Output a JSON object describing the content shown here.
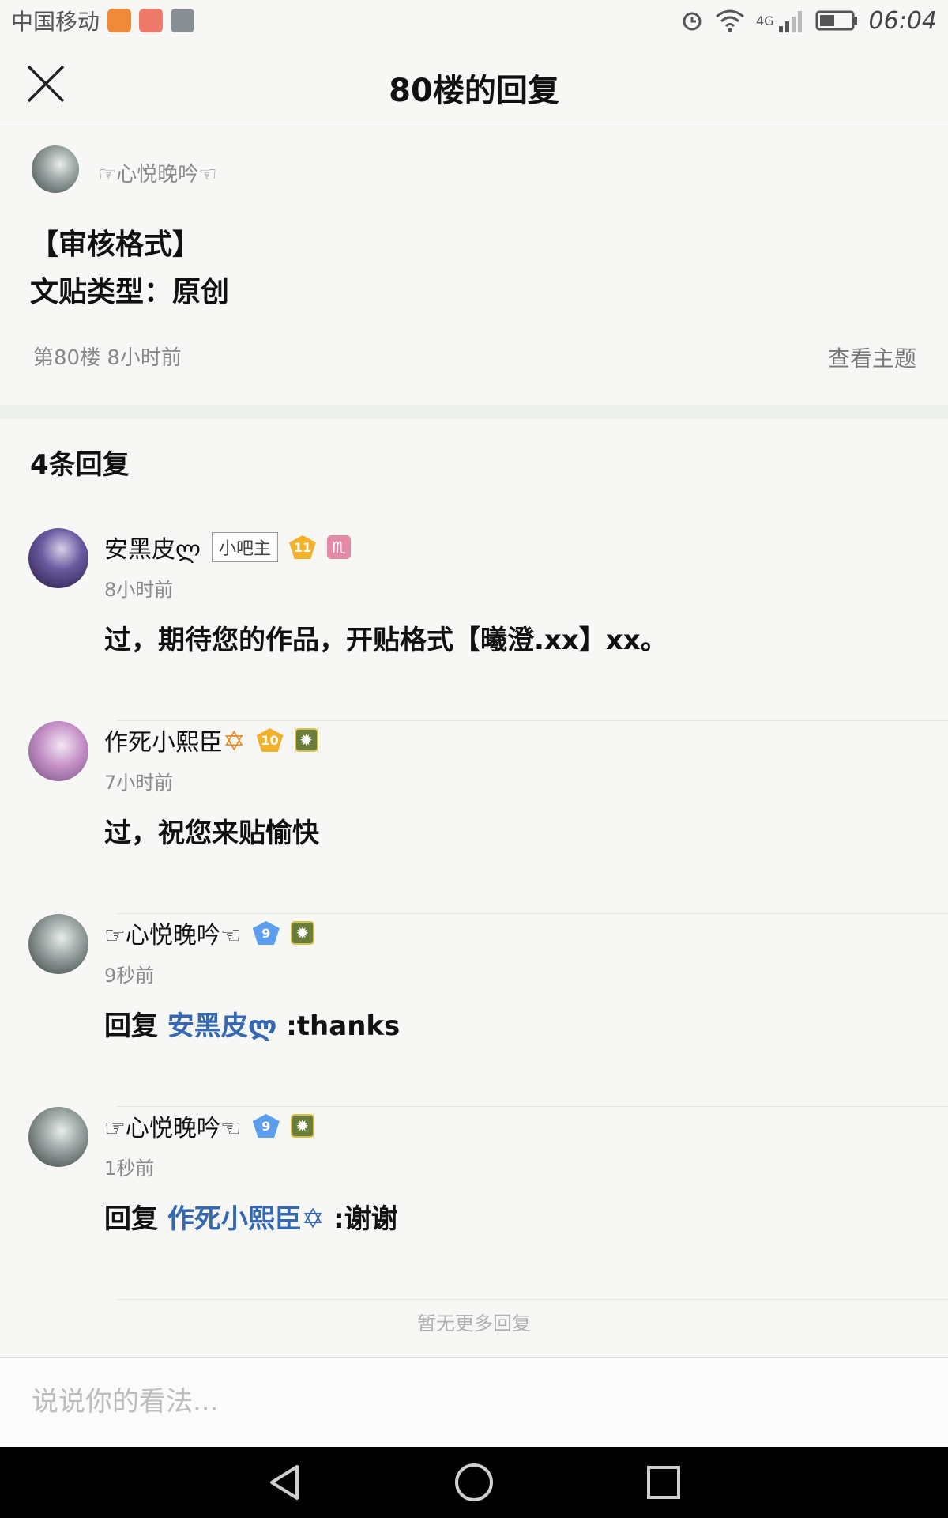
{
  "status_bar": {
    "carrier": "中国移动",
    "network": "4G",
    "time": "06:04",
    "colors": {
      "app1": "#f08a3a",
      "app2": "#f07a6a",
      "app3": "#8a8e95"
    }
  },
  "header": {
    "title": "80楼的回复",
    "close_icon": "close-icon"
  },
  "post": {
    "author": "☞心悦晚吟☜",
    "lines": [
      "【审核格式】",
      "文贴类型：原创"
    ],
    "meta": "第80楼  8小时前",
    "view_topic_label": "查看主题"
  },
  "replies": {
    "count_label": "4条回复",
    "items": [
      {
        "author": "安黑皮ლ",
        "role_badge": "小吧主",
        "level": "11",
        "level_color": "gold",
        "extra_badge": "♏",
        "time": "8小时前",
        "prefix": "",
        "mention": "",
        "text": "过，期待您的作品，开贴格式【曦澄.xx】xx。"
      },
      {
        "author": "作死小熙臣",
        "name_icon": "✡",
        "level": "10",
        "level_color": "gold",
        "extra_badge": "✹",
        "time": "7小时前",
        "prefix": "",
        "mention": "",
        "text": "过，祝您来贴愉快"
      },
      {
        "author": "☞心悦晚吟☜",
        "level": "9",
        "level_color": "blue",
        "extra_badge": "✹",
        "time": "9秒前",
        "prefix": "回复 ",
        "mention": "安黑皮ლ",
        "text": " :thanks"
      },
      {
        "author": "☞心悦晚吟☜",
        "level": "9",
        "level_color": "blue",
        "extra_badge": "✹",
        "time": "1秒前",
        "prefix": "回复 ",
        "mention": "作死小熙臣✡",
        "text": " :谢谢"
      }
    ],
    "no_more_label": "暂无更多回复"
  },
  "comment": {
    "placeholder": "说说你的看法..."
  },
  "colors": {
    "mention": "#3567b3",
    "background": "#f7f8f6"
  }
}
